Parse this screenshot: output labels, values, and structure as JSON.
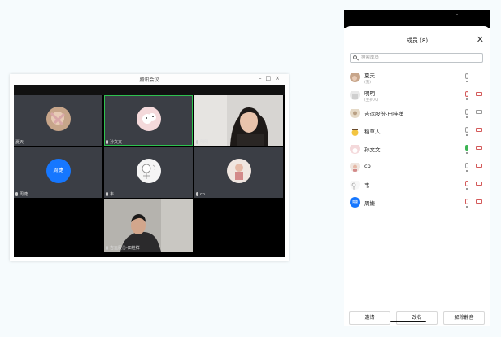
{
  "meeting_window": {
    "title": "腾讯会议",
    "controls": [
      "–",
      "□",
      "×"
    ],
    "tiles": [
      {
        "name": "夏天",
        "kind": "avatar",
        "avatar_color": "#c7a58a"
      },
      {
        "name": "孙文文",
        "kind": "avatar",
        "avatar_color": "#f4d9db",
        "active": true
      },
      {
        "name": "明明",
        "kind": "video"
      },
      {
        "name": "周婕",
        "kind": "initials",
        "avatar_color": "#1677ff"
      },
      {
        "name": "韦",
        "kind": "avatar",
        "avatar_color": "#f2f2f2"
      },
      {
        "name": "cp",
        "kind": "avatar",
        "avatar_color": "#f0e6e0"
      },
      {
        "name": "",
        "kind": "black"
      },
      {
        "name": "吉运股份-田桂祥",
        "kind": "video"
      },
      {
        "name": "",
        "kind": "black"
      }
    ]
  },
  "member_panel": {
    "title": "成员 (8)",
    "close_icon": "close-icon",
    "search_placeholder": "搜索成员",
    "members": [
      {
        "name": "夏天",
        "sub": "(我)",
        "mic": "grey",
        "cam": "none",
        "avatar_color": "#c7a58a"
      },
      {
        "name": "明明",
        "sub": "(主持人)",
        "mic": "red",
        "cam": "red",
        "avatar_color": "#e8e8e8"
      },
      {
        "name": "吉运股份-田桂祥",
        "sub": "",
        "mic": "grey",
        "cam": "grey",
        "avatar_color": "#e5d9c6"
      },
      {
        "name": "稻草人",
        "sub": "",
        "mic": "grey",
        "cam": "red",
        "avatar_color": "#f3c541"
      },
      {
        "name": "孙文文",
        "sub": "",
        "mic": "green",
        "cam": "red",
        "avatar_color": "#f4d9db"
      },
      {
        "name": "cp",
        "sub": "",
        "mic": "grey",
        "cam": "red",
        "avatar_color": "#f0e6e0"
      },
      {
        "name": "韦",
        "sub": "",
        "mic": "red",
        "cam": "red",
        "avatar_color": "#f2f2f2"
      },
      {
        "name": "周婕",
        "sub": "",
        "mic": "red",
        "cam": "red",
        "avatar_color": "#1677ff"
      }
    ],
    "buttons": {
      "invite": "邀请",
      "rename": "改名",
      "unmute_all": "解除静音"
    }
  },
  "colors": {
    "active_border": "#2ec24f",
    "muted_red": "#d45a5a",
    "speaking_green": "#3cb454"
  }
}
